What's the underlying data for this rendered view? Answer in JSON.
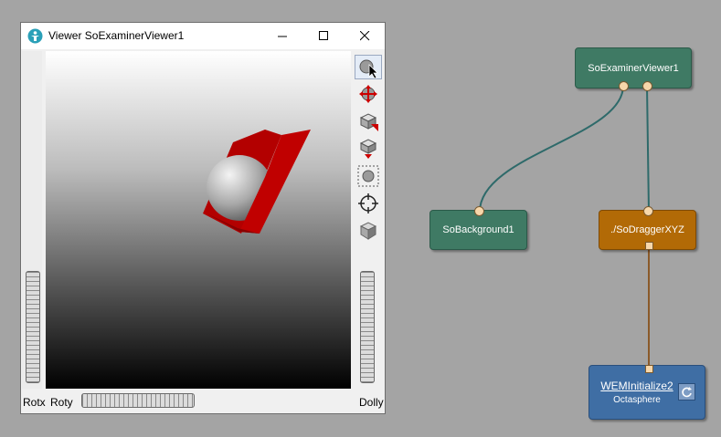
{
  "viewer_window": {
    "title": "Viewer SoExaminerViewer1",
    "controls": [
      "minimize-icon",
      "maximize-icon",
      "close-icon"
    ],
    "tools": [
      "pick-icon",
      "view-icon",
      "home-icon",
      "set-home-icon",
      "view-all-icon",
      "seek-icon",
      "projection-icon"
    ],
    "labels": {
      "rotx": "Rotx",
      "roty": "Roty",
      "dolly": "Dolly"
    }
  },
  "network": {
    "nodes": {
      "viewer": {
        "label": "SoExaminerViewer1"
      },
      "background": {
        "label": "SoBackground1"
      },
      "dragger": {
        "label": "./SoDraggerXYZ"
      },
      "wem": {
        "label": "WEMInitialize2",
        "sublabel": "Octasphere"
      }
    },
    "colors": {
      "module_green": "#3f7a64",
      "macro_orange": "#b26a06",
      "ml_blue": "#3f6ea4",
      "scene_wire": "#2e6a6a",
      "data_wire": "#8a5a2a"
    }
  }
}
